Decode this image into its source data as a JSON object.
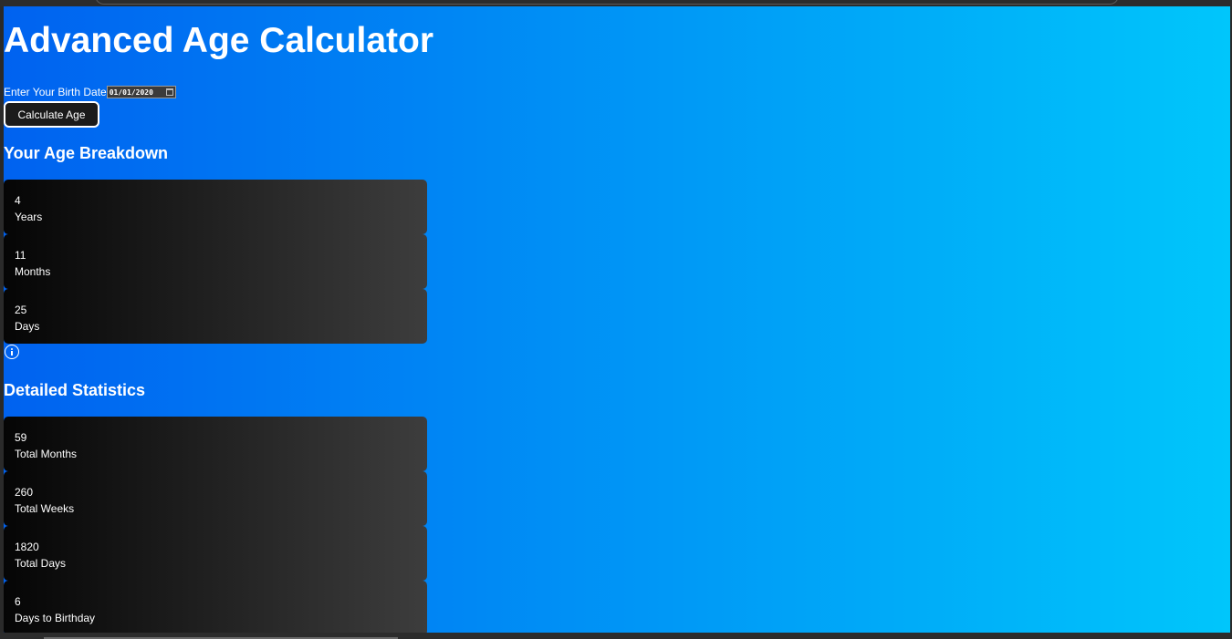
{
  "app": {
    "title": "Advanced Age Calculator"
  },
  "form": {
    "birth_label": "Enter Your Birth Date",
    "birth_value": "01/01/2020",
    "calculate_label": "Calculate Age"
  },
  "breakdown": {
    "heading": "Your Age Breakdown",
    "items": [
      {
        "value": "4",
        "label": "Years"
      },
      {
        "value": "11",
        "label": "Months"
      },
      {
        "value": "25",
        "label": "Days"
      }
    ]
  },
  "stats": {
    "heading": "Detailed Statistics",
    "items": [
      {
        "value": "59",
        "label": "Total Months"
      },
      {
        "value": "260",
        "label": "Total Weeks"
      },
      {
        "value": "1820",
        "label": "Total Days"
      },
      {
        "value": "6",
        "label": "Days to Birthday"
      }
    ]
  },
  "icons": {
    "info": "info-icon",
    "calendar": "calendar-icon"
  },
  "colors": {
    "gradient_start": "#0062f0",
    "gradient_end": "#00c6fb",
    "card_start": "#050505",
    "card_end": "#3d3d3d",
    "text": "#ffffff"
  }
}
